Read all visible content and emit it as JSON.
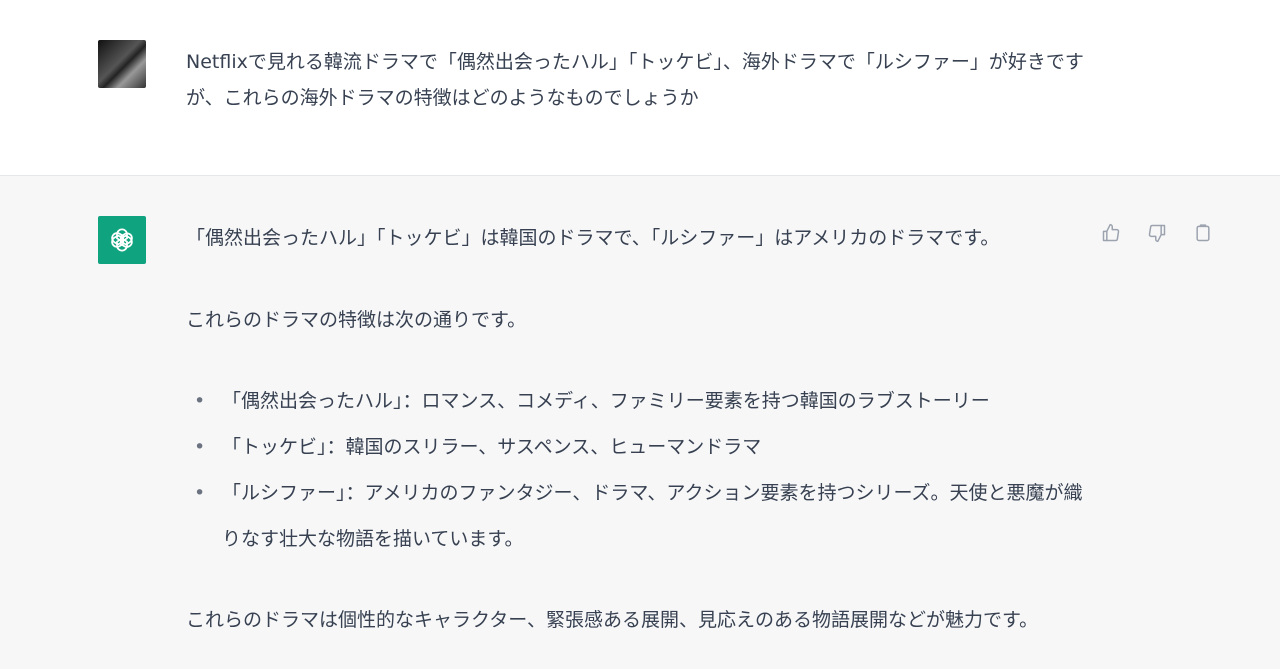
{
  "user": {
    "text": "Netflixで見れる韓流ドラマで「偶然出会ったハル」「トッケビ」、海外ドラマで「ルシファー」が好きですが、これらの海外ドラマの特徴はどのようなものでしょうか"
  },
  "assistant": {
    "intro": "「偶然出会ったハル」「トッケビ」は韓国のドラマで、「ルシファー」はアメリカのドラマです。",
    "lead": "これらのドラマの特徴は次の通りです。",
    "bullet": "•",
    "items": [
      "「偶然出会ったハル」：ロマンス、コメディ、ファミリー要素を持つ韓国のラブストーリー",
      "「トッケビ」：韓国のスリラー、サスペンス、ヒューマンドラマ",
      "「ルシファー」：アメリカのファンタジー、ドラマ、アクション要素を持つシリーズ。天使と悪魔が織りなす壮大な物語を描いています。"
    ],
    "closing": "これらのドラマは個性的なキャラクター、緊張感ある展開、見応えのある物語展開などが魅力です。"
  },
  "icons": {
    "user_avatar": "user-avatar",
    "bot_avatar": "openai-logo-icon",
    "thumbs_up": "thumbs-up-icon",
    "thumbs_down": "thumbs-down-icon",
    "copy": "copy-icon"
  },
  "colors": {
    "accent": "#10a37f",
    "assistant_bg": "#f7f7f8",
    "text": "#374151"
  }
}
